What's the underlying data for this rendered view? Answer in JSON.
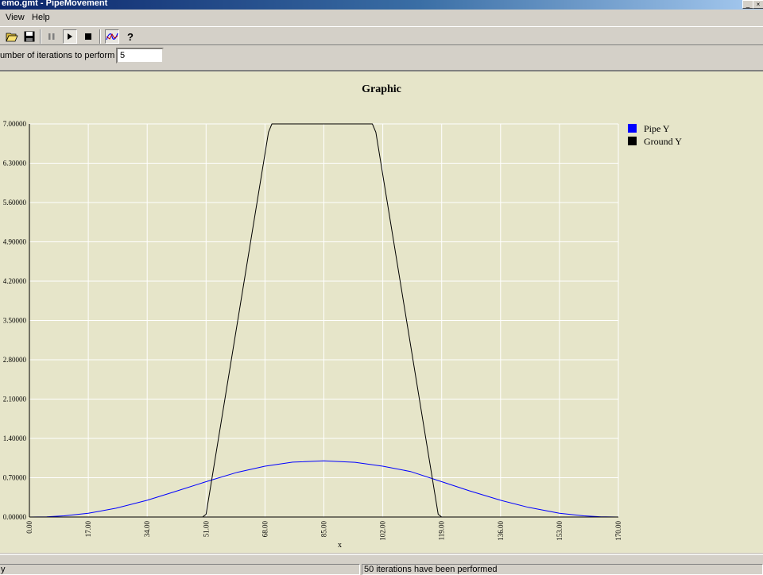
{
  "window": {
    "title": "emo.gmt - PipeMovement"
  },
  "menu": {
    "view": "View",
    "help": "Help"
  },
  "toolbar": {
    "buttons": [
      "open-folder-icon",
      "save-icon",
      "pause-icon",
      "play-icon",
      "stop-icon",
      "graph-icon",
      "help-icon"
    ]
  },
  "iterations": {
    "label": "Number of iterations to perform",
    "value": "5"
  },
  "status": {
    "left": "y",
    "right": "50 iterations have been performed"
  },
  "colors": {
    "pipe": "#0000ff",
    "ground": "#000000",
    "plot_bg": "#e6e5c9",
    "grid": "#ffffff"
  },
  "chart_data": {
    "type": "line",
    "title": "Graphic",
    "xlabel": "x",
    "ylabel": "",
    "xlim": [
      0,
      170
    ],
    "ylim": [
      0,
      7
    ],
    "x_ticks": [
      "0.00",
      "17.00",
      "34.00",
      "51.00",
      "68.00",
      "85.00",
      "102.00",
      "119.00",
      "136.00",
      "153.00",
      "170.00"
    ],
    "y_ticks": [
      "0.00000",
      "0.70000",
      "1.40000",
      "2.10000",
      "2.80000",
      "3.50000",
      "4.20000",
      "4.90000",
      "5.60000",
      "6.30000",
      "7.00000"
    ],
    "y_tick_values": [
      0,
      0.7,
      1.4,
      2.1,
      2.8,
      3.5,
      4.2,
      4.9,
      5.6,
      6.3,
      7
    ],
    "x_tick_values": [
      0,
      17,
      34,
      51,
      68,
      85,
      102,
      119,
      136,
      153,
      170
    ],
    "grid": true,
    "legend_position": "top-right",
    "series": [
      {
        "name": "Pipe Y",
        "color": "#0000ff",
        "x": [
          0,
          5,
          10,
          17,
          25,
          34,
          42,
          51,
          60,
          68,
          76,
          85,
          94,
          102,
          110,
          119,
          127,
          136,
          144,
          153,
          160,
          165,
          170
        ],
        "y": [
          0,
          0.004,
          0.021,
          0.067,
          0.157,
          0.299,
          0.452,
          0.63,
          0.796,
          0.905,
          0.977,
          1.0,
          0.975,
          0.905,
          0.81,
          0.63,
          0.467,
          0.299,
          0.172,
          0.067,
          0.021,
          0.004,
          0
        ]
      },
      {
        "name": "Ground Y",
        "color": "#000000",
        "x": [
          0,
          50,
          51,
          69,
          70,
          99,
          100,
          118,
          119,
          170
        ],
        "y": [
          0,
          0,
          0.05,
          6.85,
          7,
          7,
          6.85,
          0.05,
          0,
          0
        ]
      }
    ]
  }
}
